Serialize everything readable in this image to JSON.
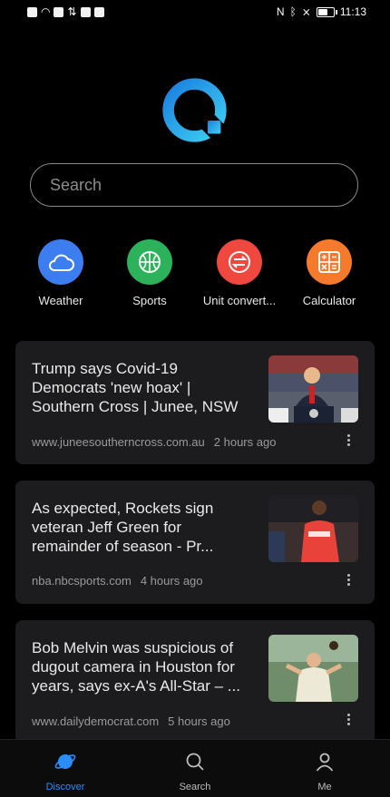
{
  "status_bar": {
    "time": "11:13",
    "battery_level": 0.65
  },
  "search": {
    "placeholder": "Search"
  },
  "shortcuts": [
    {
      "label": "Weather",
      "icon": "cloud-icon",
      "color": "#3c7ef0"
    },
    {
      "label": "Sports",
      "icon": "basketball-icon",
      "color": "#2bb25a"
    },
    {
      "label": "Unit convert...",
      "icon": "convert-icon",
      "color": "#f0473f"
    },
    {
      "label": "Calculator",
      "icon": "calculator-icon",
      "color": "#f57a2b"
    }
  ],
  "news": [
    {
      "title": "Trump says Covid-19 Democrats 'new hoax' | Southern Cross | Junee, NSW",
      "source": "www.juneesoutherncross.com.au",
      "time": "2 hours ago"
    },
    {
      "title": "As expected, Rockets sign veteran Jeff Green for remainder of season - Pr...",
      "source": "nba.nbcsports.com",
      "time": "4 hours ago"
    },
    {
      "title": "Bob Melvin was suspicious of dugout camera in Houston for years, says ex-A's All-Star – ...",
      "source": "www.dailydemocrat.com",
      "time": "5 hours ago"
    }
  ],
  "bottom_nav": [
    {
      "label": "Discover",
      "active": true
    },
    {
      "label": "Search",
      "active": false
    },
    {
      "label": "Me",
      "active": false
    }
  ],
  "colors": {
    "accent": "#2a8dff",
    "card_bg": "#1c1c1e",
    "logo_gradient_start": "#1a8fe8",
    "logo_gradient_end": "#36c7f0"
  }
}
